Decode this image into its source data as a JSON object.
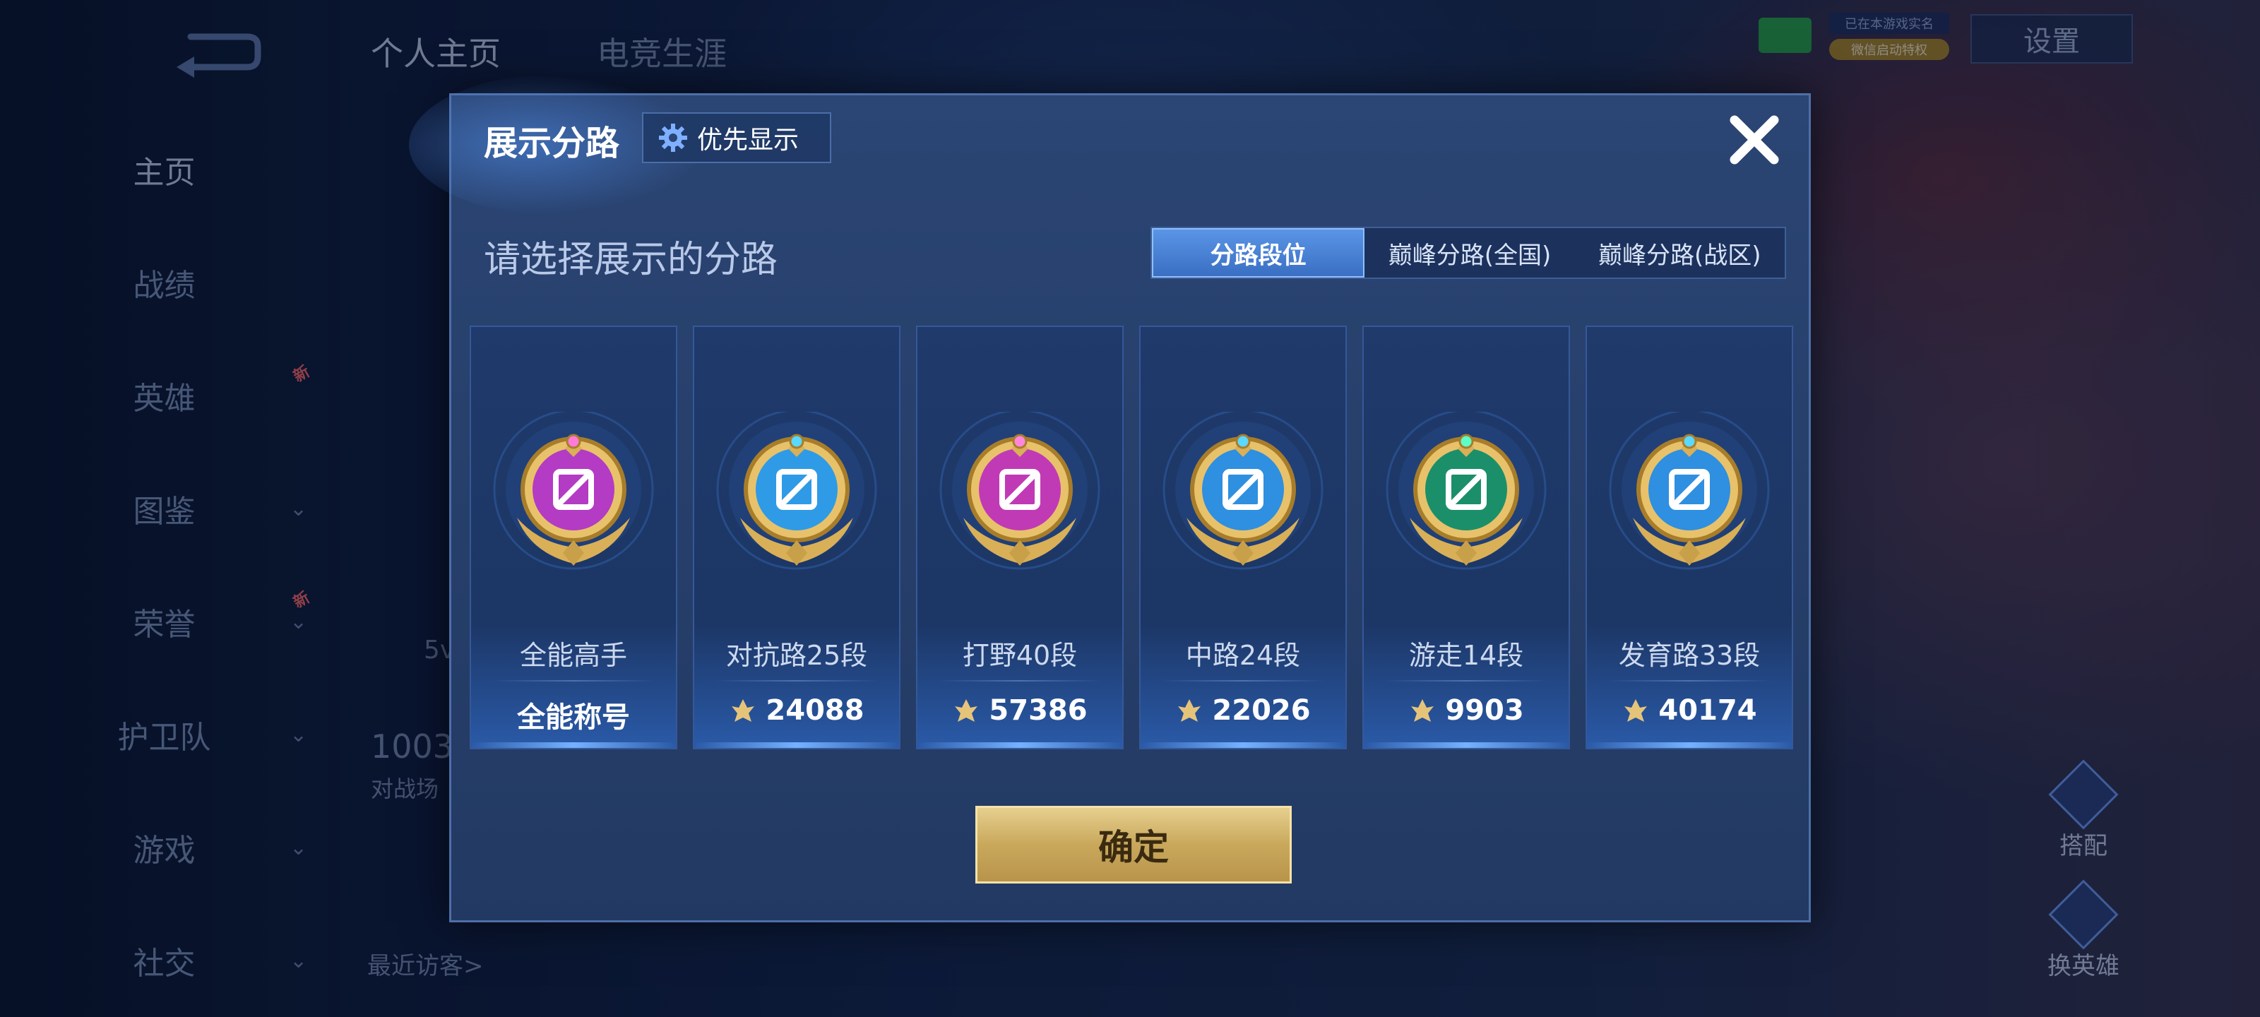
{
  "background": {
    "top_tabs": [
      "个人主页",
      "电竞生涯"
    ],
    "sidebar": [
      {
        "label": "主页",
        "active": true,
        "chevron": false,
        "new": false
      },
      {
        "label": "战绩",
        "active": false,
        "chevron": false,
        "new": false
      },
      {
        "label": "英雄",
        "active": false,
        "chevron": false,
        "new": true
      },
      {
        "label": "图鉴",
        "active": false,
        "chevron": true,
        "new": false
      },
      {
        "label": "荣誉",
        "active": false,
        "chevron": true,
        "new": true
      },
      {
        "label": "护卫队",
        "active": false,
        "chevron": true,
        "new": false
      },
      {
        "label": "游戏",
        "active": false,
        "chevron": true,
        "new": false
      },
      {
        "label": "社交",
        "active": false,
        "chevron": true,
        "new": false
      }
    ],
    "new_badge": "新",
    "settings_label": "设置",
    "realname_text": "已在本游戏实名",
    "helper_text": "微信启动特权",
    "recent_visitors": "最近访客>",
    "number_fragment": "1003",
    "battle_fragment": "对战场",
    "level_fragment": "5v",
    "right_buttons": [
      "搭配",
      "换英雄"
    ]
  },
  "dialog": {
    "title": "展示分路",
    "priority_button": "优先显示",
    "subtitle": "请选择展示的分路",
    "tabs": [
      {
        "label": "分路段位",
        "active": true
      },
      {
        "label": "巅峰分路(全国)",
        "active": false
      },
      {
        "label": "巅峰分路(战区)",
        "active": false
      }
    ],
    "cards": [
      {
        "name": "全能高手",
        "score": "全能称号",
        "has_icon": false,
        "color": "#b43bc4",
        "gem": "#ff7ad9"
      },
      {
        "name": "对抗路25段",
        "score": "24088",
        "has_icon": true,
        "color": "#2f9be6",
        "gem": "#5ad8ff"
      },
      {
        "name": "打野40段",
        "score": "57386",
        "has_icon": true,
        "color": "#c13ab5",
        "gem": "#ff86dd"
      },
      {
        "name": "中路24段",
        "score": "22026",
        "has_icon": true,
        "color": "#2f8fe0",
        "gem": "#5ad8ff"
      },
      {
        "name": "游走14段",
        "score": "9903",
        "has_icon": true,
        "color": "#1b8f6a",
        "gem": "#5dffc6"
      },
      {
        "name": "发育路33段",
        "score": "40174",
        "has_icon": true,
        "color": "#2f8fe0",
        "gem": "#5ad8ff"
      }
    ],
    "confirm_button": "确定"
  }
}
